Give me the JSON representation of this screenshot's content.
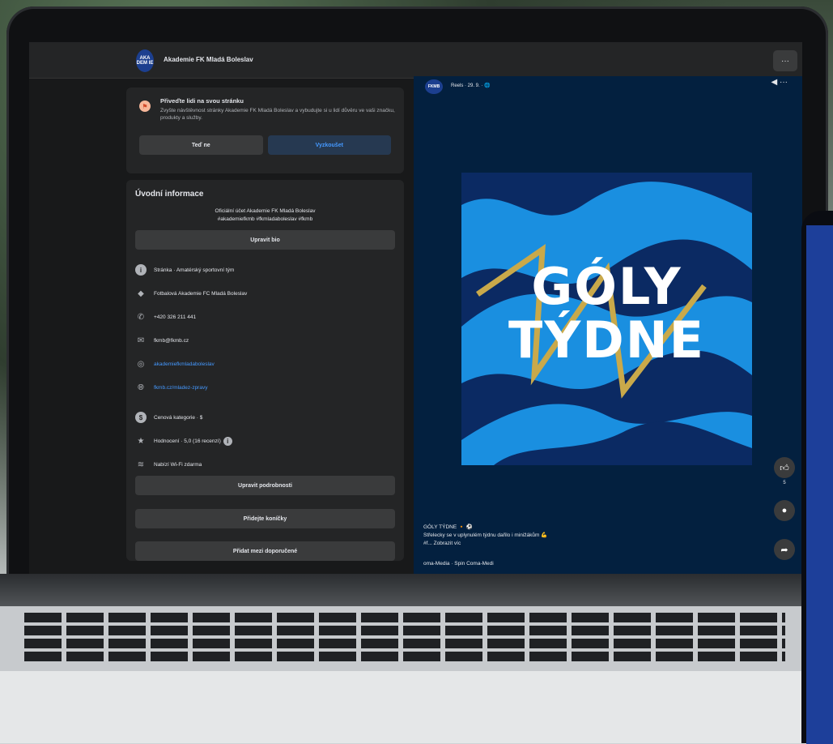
{
  "header": {
    "page_name": "Akademie FK Mladá Boleslav",
    "logo_text": "AKA DEM IE",
    "more_label": "···"
  },
  "promo": {
    "title": "Přiveďte lidi na svou stránku",
    "text": "Zvyšte návštěvnost stránky Akademie FK Mladá Boleslav a vybudujte si u lidí důvěru ve vaši značku, produkty a služby.",
    "btn_later": "Teď ne",
    "btn_try": "Vyzkoušet"
  },
  "intro": {
    "title": "Úvodní informace",
    "bio_line1": "Oficiální účet Akademie FK Mladá Boleslav",
    "bio_line2": "#akademiefkmb #fkmladaboleslav #fkmb",
    "edit_bio": "Upravit bio",
    "items": [
      {
        "icon": "info-icon",
        "text": "Stránka · Amatérský sportovní tým"
      },
      {
        "icon": "location-icon",
        "text": "Fotbalová Akademie FC Mladá Boleslav"
      },
      {
        "icon": "phone-icon",
        "text": "+420 326 211 441"
      },
      {
        "icon": "email-icon",
        "text": "fkmb@fkmb.cz"
      },
      {
        "icon": "instagram-icon",
        "text": "akademiefkmladaboleslav"
      },
      {
        "icon": "globe-icon",
        "text": "fkmb.cz/mladez-zpravy"
      },
      {
        "icon": "price-icon",
        "text": "Cenová kategorie · $"
      },
      {
        "icon": "star-icon",
        "text": "Hodnocení · 5,0 (16 recenzí)"
      },
      {
        "icon": "wifi-icon",
        "text": "Nabízí Wi-Fi zdarma"
      }
    ],
    "edit_details": "Upravit podrobnosti",
    "add_hobbies": "Přidejte koníčky",
    "add_featured": "Přidat mezi doporučené"
  },
  "reel": {
    "avatar_text": "FKMB",
    "meta": "Reels · 29. 9. · 🌐",
    "poster_line1": "GÓLY",
    "poster_line2": "TÝDNE",
    "like_count": "5",
    "caption_line1": "GÓLY TÝDNE 🔸 ⚽",
    "caption_line2": "Střelecky se v uplynulém týdnu dařilo i minižákům 💪",
    "caption_line3": "#f... Zobrazit víc",
    "audio": "oma-Media · Spin     Coma-Medi"
  },
  "colors": {
    "accent": "#4599ff",
    "poster_bg": "#1a8fe0",
    "reel_bg": "#03203f",
    "card_bg": "#242526"
  }
}
